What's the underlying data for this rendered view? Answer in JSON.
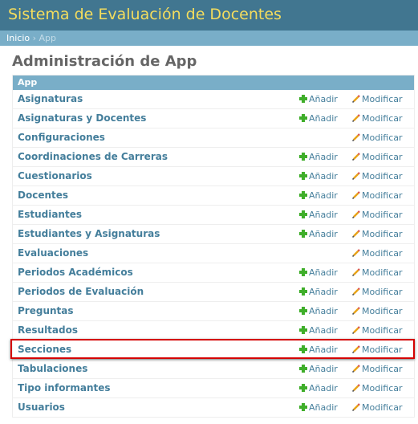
{
  "header": {
    "site_title": "Sistema de Evaluación de Docentes"
  },
  "breadcrumbs": {
    "home": "Inicio",
    "separator": "›",
    "current": "App"
  },
  "page_title": "Administración de App",
  "module": {
    "caption": "App"
  },
  "links": {
    "add": "Añadir",
    "change": "Modificar"
  },
  "models": [
    {
      "name": "Asignaturas",
      "has_add": true
    },
    {
      "name": "Asignaturas y Docentes",
      "has_add": true
    },
    {
      "name": "Configuraciones",
      "has_add": false
    },
    {
      "name": "Coordinaciones de Carreras",
      "has_add": true
    },
    {
      "name": "Cuestionarios",
      "has_add": true
    },
    {
      "name": "Docentes",
      "has_add": true
    },
    {
      "name": "Estudiantes",
      "has_add": true
    },
    {
      "name": "Estudiantes y Asignaturas",
      "has_add": true
    },
    {
      "name": "Evaluaciones",
      "has_add": false
    },
    {
      "name": "Periodos Académicos",
      "has_add": true
    },
    {
      "name": "Periodos de Evaluación",
      "has_add": true
    },
    {
      "name": "Preguntas",
      "has_add": true
    },
    {
      "name": "Resultados",
      "has_add": true
    },
    {
      "name": "Secciones",
      "has_add": true,
      "highlighted": true
    },
    {
      "name": "Tabulaciones",
      "has_add": true
    },
    {
      "name": "Tipo informantes",
      "has_add": true
    },
    {
      "name": "Usuarios",
      "has_add": true
    }
  ],
  "colors": {
    "header_bg": "#417690",
    "title_yellow": "#f5dd5d",
    "breadcrumb_bg": "#79aec8",
    "link_blue": "#447e9b",
    "add_green": "#3fae2a",
    "highlight_red": "#d40000"
  }
}
